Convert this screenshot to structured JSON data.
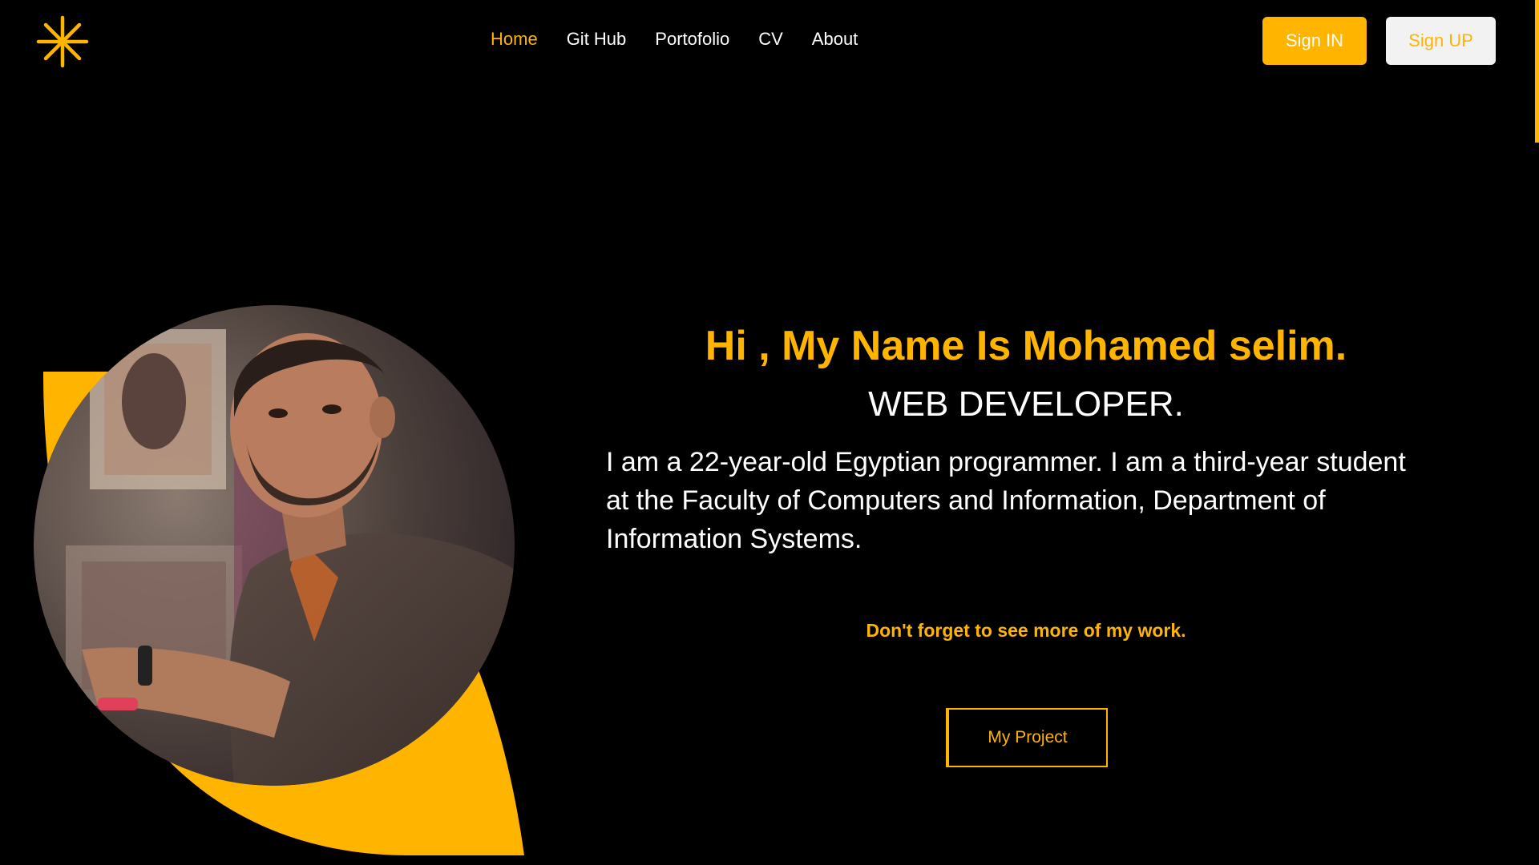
{
  "header": {
    "logo_icon": "asterisk-logo-icon",
    "nav": [
      {
        "label": "Home",
        "active": true
      },
      {
        "label": "Git Hub",
        "active": false
      },
      {
        "label": "Portofolio",
        "active": false
      },
      {
        "label": "CV",
        "active": false
      },
      {
        "label": "About",
        "active": false
      }
    ],
    "signin_label": "Sign IN",
    "signup_label": "Sign UP"
  },
  "hero": {
    "title": "Hi , My Name Is Mohamed selim.",
    "role": "WEB DEVELOPER.",
    "bio": "I am a 22-year-old Egyptian programmer. I am a third-year student at the Faculty of Computers and Information, Department of Information Systems.",
    "note": "Don't forget to see more of my work.",
    "project_button": "My Project"
  },
  "colors": {
    "accent": "#ffb400",
    "background": "#000000",
    "text": "#ffffff",
    "signup_bg": "#f2f2f2"
  }
}
